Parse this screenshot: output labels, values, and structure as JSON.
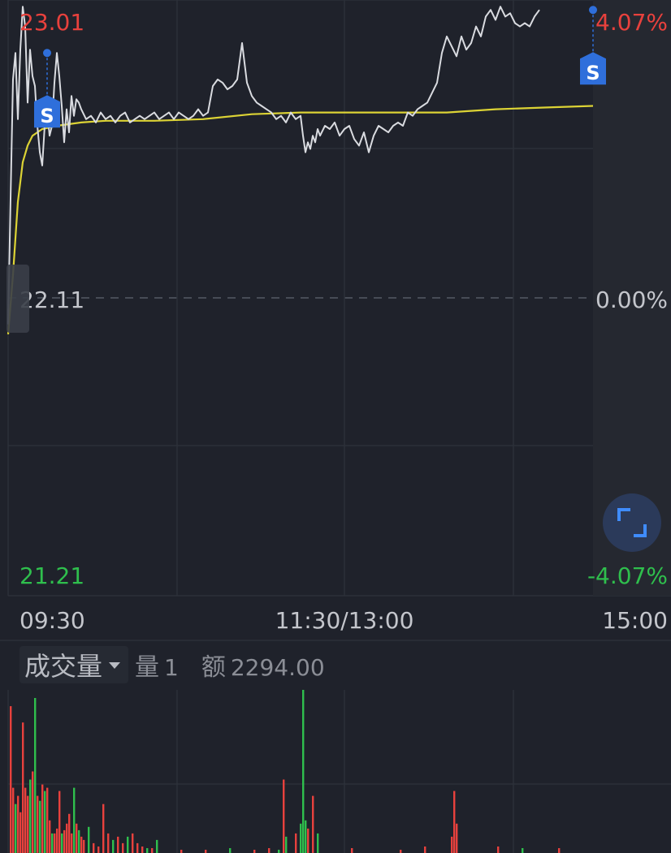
{
  "chart_data": [
    {
      "type": "line",
      "price_axis": {
        "max": "23.01",
        "mid": "22.11",
        "min": "21.21",
        "ylim": [
          21.21,
          23.01
        ]
      },
      "pct_axis": {
        "max": "4.07%",
        "mid": "0.00%",
        "min": "-4.07%"
      },
      "time_axis": {
        "ticks": [
          "09:30",
          "11:30/13:00",
          "15:00"
        ],
        "minutes": [
          0,
          120,
          240
        ]
      },
      "grid": true,
      "colors": {
        "up": "#e8413d",
        "down": "#2fbf4d",
        "price_line": "#d9dbe0",
        "avg_line": "#dcd335",
        "marker": "#2f6fdb"
      },
      "price_series": {
        "x": [
          0,
          1,
          2,
          3,
          4,
          5,
          6,
          7,
          8,
          9,
          10,
          11,
          12,
          13,
          14,
          15,
          16,
          17,
          18,
          19,
          20,
          21,
          22,
          23,
          24,
          25,
          26,
          27,
          28,
          29,
          30,
          32,
          34,
          36,
          38,
          40,
          42,
          44,
          46,
          48,
          50,
          52,
          54,
          56,
          58,
          60,
          62,
          64,
          66,
          68,
          70,
          72,
          74,
          76,
          78,
          80,
          82,
          84,
          86,
          88,
          90,
          92,
          94,
          96,
          98,
          100,
          102,
          104,
          106,
          108,
          110,
          112,
          114,
          116,
          118,
          120,
          121,
          122,
          123,
          124,
          125,
          126,
          127,
          128,
          130,
          132,
          134,
          136,
          138,
          140,
          142,
          144,
          146,
          148,
          150,
          152,
          154,
          156,
          158,
          160,
          162,
          164,
          166,
          168,
          170,
          172,
          174,
          176,
          178,
          180,
          182,
          184,
          186,
          188,
          190,
          192,
          194,
          196,
          198,
          200,
          202,
          204,
          206,
          208,
          210,
          212,
          214,
          216,
          218,
          220,
          222,
          224,
          226,
          228,
          230,
          232,
          234,
          236,
          238,
          240
        ],
        "y": [
          22.03,
          22.41,
          22.77,
          22.85,
          22.65,
          22.86,
          22.99,
          22.93,
          22.7,
          22.86,
          22.78,
          22.75,
          22.63,
          22.55,
          22.51,
          22.63,
          22.68,
          22.6,
          22.63,
          22.76,
          22.85,
          22.78,
          22.69,
          22.58,
          22.68,
          22.61,
          22.72,
          22.66,
          22.71,
          22.7,
          22.68,
          22.65,
          22.66,
          22.64,
          22.67,
          22.65,
          22.66,
          22.64,
          22.66,
          22.67,
          22.64,
          22.65,
          22.66,
          22.65,
          22.66,
          22.67,
          22.65,
          22.66,
          22.67,
          22.65,
          22.67,
          22.66,
          22.65,
          22.66,
          22.68,
          22.66,
          22.67,
          22.75,
          22.77,
          22.76,
          22.74,
          22.75,
          22.77,
          22.88,
          22.76,
          22.72,
          22.7,
          22.69,
          22.68,
          22.67,
          22.65,
          22.66,
          22.64,
          22.67,
          22.65,
          22.66,
          22.6,
          22.55,
          22.58,
          22.56,
          22.6,
          22.58,
          22.62,
          22.6,
          22.63,
          22.62,
          22.64,
          22.6,
          22.62,
          22.63,
          22.59,
          22.57,
          22.61,
          22.55,
          22.6,
          22.63,
          22.62,
          22.61,
          22.63,
          22.64,
          22.63,
          22.67,
          22.66,
          22.68,
          22.69,
          22.7,
          22.73,
          22.76,
          22.85,
          22.9,
          22.87,
          22.84,
          22.9,
          22.86,
          22.88,
          22.93,
          22.9,
          22.96,
          22.98,
          22.95,
          22.99,
          22.96,
          22.97,
          22.94,
          22.93,
          22.94,
          22.93,
          22.96,
          22.98
        ]
      },
      "avg_series": {
        "x": [
          0,
          2,
          4,
          6,
          8,
          10,
          14,
          20,
          30,
          40,
          60,
          80,
          100,
          120,
          140,
          160,
          180,
          200,
          220,
          240
        ],
        "y": [
          22.0,
          22.18,
          22.4,
          22.52,
          22.57,
          22.6,
          22.62,
          22.63,
          22.64,
          22.645,
          22.645,
          22.65,
          22.665,
          22.67,
          22.67,
          22.67,
          22.67,
          22.68,
          22.685,
          22.69
        ]
      },
      "markers": [
        {
          "label": "S",
          "x": 16,
          "y": 22.85
        },
        {
          "label": "S",
          "x": 240,
          "y": 22.98
        }
      ]
    },
    {
      "type": "bar",
      "header": {
        "selector": "成交量",
        "vol_label": "量",
        "vol_value": "1",
        "amt_label": "额",
        "amt_value": "2294.00"
      },
      "ylim": [
        0,
        100
      ],
      "bars": [
        {
          "x": 0,
          "v": 90,
          "c": "up"
        },
        {
          "x": 1,
          "v": 40,
          "c": "up"
        },
        {
          "x": 2,
          "v": 30,
          "c": "down"
        },
        {
          "x": 3,
          "v": 35,
          "c": "up"
        },
        {
          "x": 4,
          "v": 25,
          "c": "up"
        },
        {
          "x": 5,
          "v": 80,
          "c": "up"
        },
        {
          "x": 6,
          "v": 40,
          "c": "up"
        },
        {
          "x": 7,
          "v": 35,
          "c": "up"
        },
        {
          "x": 8,
          "v": 45,
          "c": "down"
        },
        {
          "x": 9,
          "v": 50,
          "c": "up"
        },
        {
          "x": 10,
          "v": 95,
          "c": "down"
        },
        {
          "x": 11,
          "v": 35,
          "c": "up"
        },
        {
          "x": 12,
          "v": 32,
          "c": "down"
        },
        {
          "x": 13,
          "v": 42,
          "c": "up"
        },
        {
          "x": 14,
          "v": 38,
          "c": "down"
        },
        {
          "x": 15,
          "v": 40,
          "c": "up"
        },
        {
          "x": 16,
          "v": 20,
          "c": "up"
        },
        {
          "x": 17,
          "v": 12,
          "c": "down"
        },
        {
          "x": 18,
          "v": 12,
          "c": "up"
        },
        {
          "x": 19,
          "v": 15,
          "c": "up"
        },
        {
          "x": 20,
          "v": 38,
          "c": "up"
        },
        {
          "x": 21,
          "v": 12,
          "c": "down"
        },
        {
          "x": 22,
          "v": 14,
          "c": "up"
        },
        {
          "x": 23,
          "v": 18,
          "c": "up"
        },
        {
          "x": 24,
          "v": 24,
          "c": "up"
        },
        {
          "x": 25,
          "v": 12,
          "c": "up"
        },
        {
          "x": 26,
          "v": 40,
          "c": "down"
        },
        {
          "x": 27,
          "v": 18,
          "c": "up"
        },
        {
          "x": 28,
          "v": 14,
          "c": "down"
        },
        {
          "x": 29,
          "v": 10,
          "c": "up"
        },
        {
          "x": 30,
          "v": 8,
          "c": "up"
        },
        {
          "x": 32,
          "v": 16,
          "c": "down"
        },
        {
          "x": 34,
          "v": 6,
          "c": "up"
        },
        {
          "x": 36,
          "v": 4,
          "c": "up"
        },
        {
          "x": 38,
          "v": 30,
          "c": "up"
        },
        {
          "x": 40,
          "v": 12,
          "c": "up"
        },
        {
          "x": 42,
          "v": 8,
          "c": "down"
        },
        {
          "x": 44,
          "v": 10,
          "c": "up"
        },
        {
          "x": 46,
          "v": 6,
          "c": "up"
        },
        {
          "x": 48,
          "v": 10,
          "c": "down"
        },
        {
          "x": 50,
          "v": 12,
          "c": "up"
        },
        {
          "x": 52,
          "v": 6,
          "c": "up"
        },
        {
          "x": 54,
          "v": 4,
          "c": "up"
        },
        {
          "x": 56,
          "v": 3,
          "c": "down"
        },
        {
          "x": 58,
          "v": 3,
          "c": "up"
        },
        {
          "x": 60,
          "v": 8,
          "c": "down"
        },
        {
          "x": 70,
          "v": 2,
          "c": "up"
        },
        {
          "x": 80,
          "v": 2,
          "c": "up"
        },
        {
          "x": 90,
          "v": 3,
          "c": "down"
        },
        {
          "x": 100,
          "v": 2,
          "c": "up"
        },
        {
          "x": 106,
          "v": 3,
          "c": "up"
        },
        {
          "x": 110,
          "v": 2,
          "c": "down"
        },
        {
          "x": 112,
          "v": 45,
          "c": "up"
        },
        {
          "x": 113,
          "v": 10,
          "c": "down"
        },
        {
          "x": 117,
          "v": 12,
          "c": "up"
        },
        {
          "x": 119,
          "v": 18,
          "c": "down"
        },
        {
          "x": 120,
          "v": 100,
          "c": "down"
        },
        {
          "x": 121,
          "v": 20,
          "c": "down"
        },
        {
          "x": 122,
          "v": 15,
          "c": "up"
        },
        {
          "x": 124,
          "v": 35,
          "c": "up"
        },
        {
          "x": 126,
          "v": 12,
          "c": "down"
        },
        {
          "x": 140,
          "v": 3,
          "c": "up"
        },
        {
          "x": 160,
          "v": 2,
          "c": "up"
        },
        {
          "x": 170,
          "v": 4,
          "c": "up"
        },
        {
          "x": 181,
          "v": 10,
          "c": "up"
        },
        {
          "x": 182,
          "v": 38,
          "c": "up"
        },
        {
          "x": 183,
          "v": 18,
          "c": "up"
        },
        {
          "x": 200,
          "v": 4,
          "c": "up"
        },
        {
          "x": 210,
          "v": 3,
          "c": "down"
        },
        {
          "x": 225,
          "v": 3,
          "c": "up"
        }
      ]
    }
  ]
}
